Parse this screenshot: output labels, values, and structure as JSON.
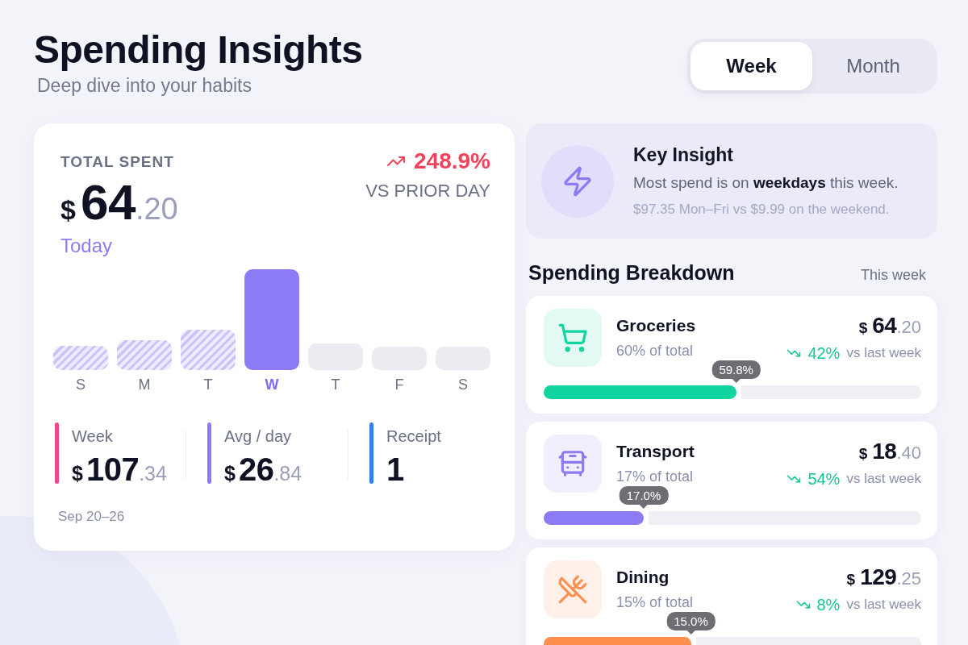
{
  "header": {
    "title": "Spending Insights",
    "subtitle": "Deep dive into your habits"
  },
  "period_tabs": [
    {
      "label": "Week",
      "selected": true
    },
    {
      "label": "Month",
      "selected": false
    }
  ],
  "summary": {
    "label": "TOTAL SPENT",
    "amount": {
      "currency": "$",
      "whole": "64",
      "cents": ".20"
    },
    "period": "Today",
    "change": {
      "kind": "up",
      "value": "248.9%",
      "caption": "VS PRIOR DAY"
    },
    "days": [
      {
        "label": "S",
        "kind": "past"
      },
      {
        "label": "M",
        "kind": "past"
      },
      {
        "label": "T",
        "kind": "past"
      },
      {
        "label": "W",
        "kind": "today"
      },
      {
        "label": "T",
        "kind": "future"
      },
      {
        "label": "F",
        "kind": "future"
      },
      {
        "label": "S",
        "kind": "future"
      }
    ],
    "stats": [
      {
        "label": "Week",
        "color": "#f0468c",
        "value": {
          "currency": "$",
          "whole": "107",
          "cents": ".34"
        }
      },
      {
        "label": "Avg / day",
        "color": "#8b7cf6",
        "value": {
          "currency": "$",
          "whole": "26",
          "cents": ".84"
        }
      },
      {
        "label": "Receipt",
        "color": "#2f80ed",
        "value": {
          "whole": "1"
        }
      }
    ],
    "date_range": "Sep 20–26"
  },
  "insight": {
    "title": "Key Insight",
    "message": "Most spend is on **weekdays** this week.",
    "detail": "$97.35 Mon–Fri vs $9.99 on the weekend."
  },
  "breakdown": {
    "title": "Spending Breakdown",
    "period": "This week",
    "categories": [
      {
        "kind": "groceries",
        "name": "Groceries",
        "share": "60% of total",
        "amount": {
          "currency": "$",
          "whole": "64",
          "cents": ".20"
        },
        "change": {
          "kind": "down",
          "value": "42%",
          "caption": "vs last week"
        },
        "tooltip": "59.8%",
        "level": 0.51,
        "color": "#10d49f"
      },
      {
        "kind": "transport",
        "name": "Transport",
        "share": "17% of total",
        "amount": {
          "currency": "$",
          "whole": "18",
          "cents": ".40"
        },
        "change": {
          "kind": "down",
          "value": "54%",
          "caption": "vs last week"
        },
        "tooltip": "17.0%",
        "level": 0.265,
        "color": "#8b7cf6"
      },
      {
        "kind": "dining",
        "name": "Dining",
        "share": "15% of total",
        "amount": {
          "currency": "$",
          "whole": "129",
          "cents": ".25"
        },
        "change": {
          "kind": "down",
          "value": "8%",
          "caption": "vs last week"
        },
        "tooltip": "15.0%",
        "level": 0.39,
        "color": "#ff8f4f"
      }
    ]
  }
}
